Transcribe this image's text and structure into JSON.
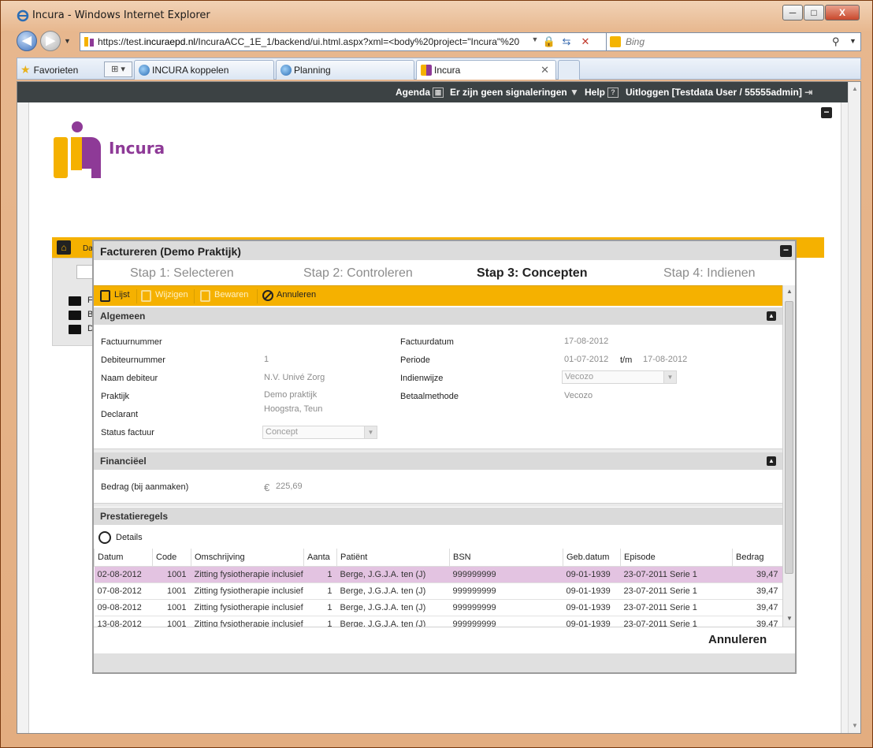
{
  "window": {
    "title": "Incura - Windows Internet Explorer",
    "minimize": "─",
    "maximize": "□",
    "close": "X"
  },
  "nav": {
    "back": "◀",
    "forward": "▶",
    "url_prefix": "https://test.",
    "url_domain": "incuraepd.nl",
    "url_rest": "/IncuraACC_1E_1/backend/ui.html.aspx?xml=<body%20project=\"Incura\"%20",
    "search_placeholder": "Bing"
  },
  "tabs": {
    "favorites": "Favorieten",
    "items": [
      {
        "label": "INCURA koppelen"
      },
      {
        "label": "Planning"
      },
      {
        "label": "Incura"
      }
    ]
  },
  "appbar": {
    "agenda": "Agenda",
    "signals": "Er zijn geen signaleringen",
    "help": "Help",
    "logout": "Uitloggen [Testdata User / 55555admin]"
  },
  "logo": {
    "text": "Incura"
  },
  "background": {
    "strip_label": "Da",
    "folders": [
      "F",
      "B",
      "D"
    ]
  },
  "dialog": {
    "title": "Factureren  (Demo Praktijk)",
    "steps": [
      {
        "label": "Stap 1: Selecteren",
        "active": false
      },
      {
        "label": "Stap 2: Controleren",
        "active": false
      },
      {
        "label": "Stap 3: Concepten",
        "active": true
      },
      {
        "label": "Stap 4: Indienen",
        "active": false
      }
    ],
    "toolbar": {
      "list": "Lijst",
      "edit": "Wijzigen",
      "save": "Bewaren",
      "cancel": "Annuleren"
    },
    "general": {
      "title": "Algemeen",
      "invoice_number_label": "Factuurnummer",
      "invoice_number": "",
      "debtor_number_label": "Debiteurnummer",
      "debtor_number": "1",
      "debtor_name_label": "Naam debiteur",
      "debtor_name": "N.V. Univé Zorg",
      "practice_label": "Praktijk",
      "practice": "Demo praktijk",
      "declarant_label": "Declarant",
      "declarant": "Hoogstra, Teun",
      "status_label": "Status factuur",
      "status": "Concept",
      "invoice_date_label": "Factuurdatum",
      "invoice_date": "17-08-2012",
      "period_label": "Periode",
      "period_from": "01-07-2012",
      "period_sep": "t/m",
      "period_to": "17-08-2012",
      "submission_label": "Indienwijze",
      "submission": "Vecozo",
      "payment_label": "Betaalmethode",
      "payment": "Vecozo"
    },
    "financial": {
      "title": "Financiëel",
      "amount_label": "Bedrag (bij aanmaken)",
      "currency": "€",
      "amount": "225,69"
    },
    "services": {
      "title": "Prestatieregels",
      "details": "Details",
      "columns": [
        "Datum",
        "Code",
        "Omschrijving",
        "Aanta",
        "Patiënt",
        "BSN",
        "Geb.datum",
        "Episode",
        "Bedrag"
      ],
      "rows": [
        [
          "02-08-2012",
          "1001",
          "Zitting  fysiotherapie inclusief",
          "1",
          "Berge, J.G.J.A. ten (J)",
          "999999999",
          "09-01-1939",
          "23-07-2011 Serie 1",
          "39,47"
        ],
        [
          "07-08-2012",
          "1001",
          "Zitting  fysiotherapie inclusief",
          "1",
          "Berge, J.G.J.A. ten (J)",
          "999999999",
          "09-01-1939",
          "23-07-2011 Serie 1",
          "39,47"
        ],
        [
          "09-08-2012",
          "1001",
          "Zitting  fysiotherapie inclusief",
          "1",
          "Berge, J.G.J.A. ten (J)",
          "999999999",
          "09-01-1939",
          "23-07-2011 Serie 1",
          "39,47"
        ],
        [
          "13-08-2012",
          "1001",
          "Zitting  fysiotherapie inclusief",
          "1",
          "Berge, J.G.J.A. ten (J)",
          "999999999",
          "09-01-1939",
          "23-07-2011 Serie 1",
          "39,47"
        ]
      ]
    },
    "footer": {
      "cancel": "Annuleren"
    }
  },
  "colors": {
    "accent": "#f5b100",
    "logo_purple": "#8e3a97",
    "selected_row": "#e3c3e1",
    "appbar": "#3c4244"
  }
}
